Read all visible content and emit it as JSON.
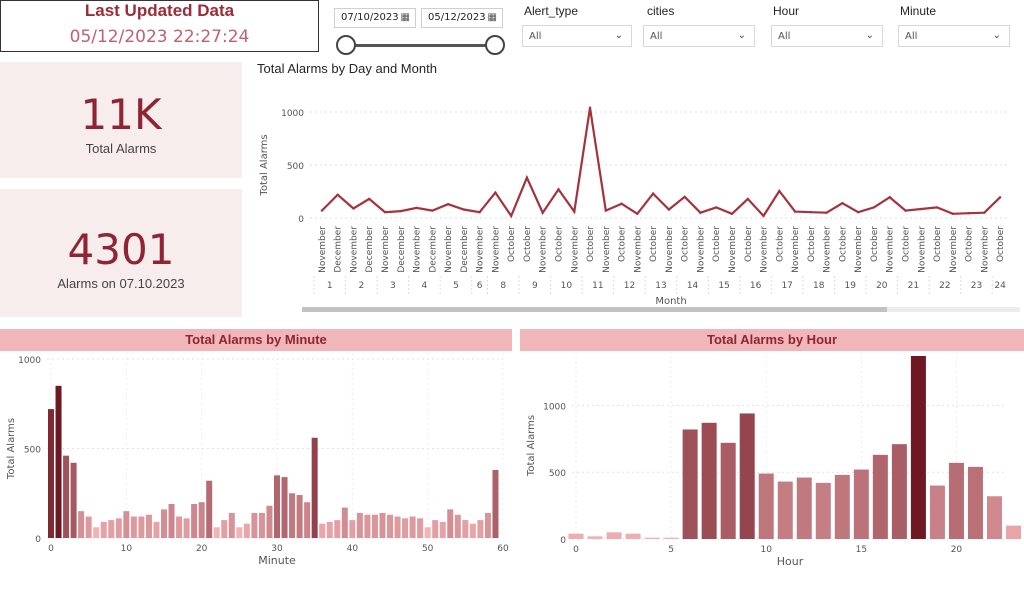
{
  "header": {
    "title": "Last Updated Data",
    "timestamp": "05/12/2023 22:27:24"
  },
  "date_range": {
    "start": "07/10/2023",
    "end": "05/12/2023",
    "calendar_icon": "calendar-icon"
  },
  "slicers": [
    {
      "title": "Alert_type",
      "value": "All"
    },
    {
      "title": "cities",
      "value": "All"
    },
    {
      "title": "Hour",
      "value": "All"
    },
    {
      "title": "Minute",
      "value": "All"
    }
  ],
  "kpis": {
    "total": {
      "value": "11K",
      "label": "Total Alarms"
    },
    "day": {
      "value": "4301",
      "label": "Alarms on 07.10.2023"
    }
  },
  "charts": {
    "day_month_title": "Total Alarms by Day and Month",
    "minute_title": "Total Alarms by Minute",
    "hour_title": "Total Alarms by Hour"
  },
  "colors": {
    "line": "#a3333d",
    "band": "#f0b6b8",
    "accent": "#8e2434"
  },
  "chart_data": [
    {
      "type": "line",
      "title": "Total Alarms by Day and Month",
      "xlabel": "Month",
      "ylabel": "Total Alarms",
      "ylim": [
        0,
        1000
      ],
      "yticks": [
        0,
        500,
        1000
      ],
      "points": [
        {
          "month": "November",
          "day": "1",
          "value": 70
        },
        {
          "month": "December",
          "day": "1",
          "value": 220
        },
        {
          "month": "November",
          "day": "2",
          "value": 90
        },
        {
          "month": "December",
          "day": "2",
          "value": 180
        },
        {
          "month": "November",
          "day": "3",
          "value": 55
        },
        {
          "month": "December",
          "day": "3",
          "value": 65
        },
        {
          "month": "November",
          "day": "4",
          "value": 95
        },
        {
          "month": "December",
          "day": "4",
          "value": 70
        },
        {
          "month": "November",
          "day": "5",
          "value": 130
        },
        {
          "month": "December",
          "day": "5",
          "value": 80
        },
        {
          "month": "November",
          "day": "6",
          "value": 55
        },
        {
          "month": "November",
          "day": "8",
          "value": 240
        },
        {
          "month": "October",
          "day": "8",
          "value": 20
        },
        {
          "month": "October",
          "day": "9",
          "value": 380
        },
        {
          "month": "November",
          "day": "9",
          "value": 50
        },
        {
          "month": "October",
          "day": "10",
          "value": 270
        },
        {
          "month": "November",
          "day": "10",
          "value": 60
        },
        {
          "month": "October",
          "day": "11",
          "value": 1040
        },
        {
          "month": "November",
          "day": "11",
          "value": 70
        },
        {
          "month": "October",
          "day": "12",
          "value": 135
        },
        {
          "month": "November",
          "day": "12",
          "value": 40
        },
        {
          "month": "October",
          "day": "13",
          "value": 230
        },
        {
          "month": "November",
          "day": "13",
          "value": 80
        },
        {
          "month": "October",
          "day": "14",
          "value": 200
        },
        {
          "month": "November",
          "day": "14",
          "value": 50
        },
        {
          "month": "October",
          "day": "15",
          "value": 100
        },
        {
          "month": "November",
          "day": "15",
          "value": 40
        },
        {
          "month": "October",
          "day": "16",
          "value": 180
        },
        {
          "month": "November",
          "day": "16",
          "value": 20
        },
        {
          "month": "October",
          "day": "17",
          "value": 255
        },
        {
          "month": "November",
          "day": "17",
          "value": 60
        },
        {
          "month": "October",
          "day": "18",
          "value": 55
        },
        {
          "month": "November",
          "day": "18",
          "value": 50
        },
        {
          "month": "October",
          "day": "19",
          "value": 140
        },
        {
          "month": "November",
          "day": "19",
          "value": 55
        },
        {
          "month": "October",
          "day": "20",
          "value": 100
        },
        {
          "month": "November",
          "day": "20",
          "value": 195
        },
        {
          "month": "October",
          "day": "21",
          "value": 70
        },
        {
          "month": "November",
          "day": "21",
          "value": 85
        },
        {
          "month": "October",
          "day": "22",
          "value": 100
        },
        {
          "month": "November",
          "day": "22",
          "value": 40
        },
        {
          "month": "October",
          "day": "23",
          "value": 45
        },
        {
          "month": "November",
          "day": "23",
          "value": 50
        },
        {
          "month": "October",
          "day": "24",
          "value": 195
        }
      ],
      "days": [
        "1",
        "2",
        "3",
        "4",
        "5",
        "6",
        "8",
        "9",
        "10",
        "11",
        "12",
        "13",
        "14",
        "15",
        "16",
        "17",
        "18",
        "19",
        "20",
        "21",
        "22",
        "23",
        "24"
      ]
    },
    {
      "type": "bar",
      "title": "Total Alarms by Minute",
      "xlabel": "Minute",
      "ylabel": "Total Alarms",
      "ylim": [
        0,
        1000
      ],
      "yticks": [
        0,
        500,
        1000
      ],
      "xticks": [
        0,
        10,
        20,
        30,
        40,
        50,
        60
      ],
      "x": [
        0,
        1,
        2,
        3,
        4,
        5,
        6,
        7,
        8,
        9,
        10,
        11,
        12,
        13,
        14,
        15,
        16,
        17,
        18,
        19,
        20,
        21,
        22,
        23,
        24,
        25,
        26,
        27,
        28,
        29,
        30,
        31,
        32,
        33,
        34,
        35,
        36,
        37,
        38,
        39,
        40,
        41,
        42,
        43,
        44,
        45,
        46,
        47,
        48,
        49,
        50,
        51,
        52,
        53,
        54,
        55,
        56,
        57,
        58,
        59
      ],
      "values": [
        720,
        850,
        460,
        420,
        150,
        120,
        60,
        90,
        100,
        110,
        150,
        120,
        120,
        130,
        90,
        160,
        190,
        120,
        110,
        190,
        200,
        320,
        60,
        100,
        140,
        60,
        80,
        140,
        140,
        180,
        350,
        340,
        250,
        240,
        200,
        560,
        80,
        90,
        100,
        170,
        100,
        140,
        130,
        130,
        140,
        130,
        120,
        110,
        120,
        110,
        60,
        100,
        90,
        160,
        130,
        100,
        80,
        100,
        140,
        380
      ]
    },
    {
      "type": "bar",
      "title": "Total Alarms by Hour",
      "xlabel": "Hour",
      "ylabel": "Total Alarms",
      "ylim": [
        0,
        1400
      ],
      "yticks": [
        0,
        500,
        1000
      ],
      "xticks": [
        0,
        5,
        10,
        15,
        20
      ],
      "x": [
        0,
        1,
        2,
        3,
        4,
        5,
        6,
        7,
        8,
        9,
        10,
        11,
        12,
        13,
        14,
        15,
        16,
        17,
        18,
        19,
        20,
        21,
        22,
        23
      ],
      "values": [
        40,
        20,
        50,
        40,
        10,
        10,
        820,
        870,
        720,
        940,
        490,
        430,
        460,
        420,
        480,
        520,
        630,
        710,
        1370,
        400,
        570,
        540,
        320,
        100
      ]
    }
  ]
}
